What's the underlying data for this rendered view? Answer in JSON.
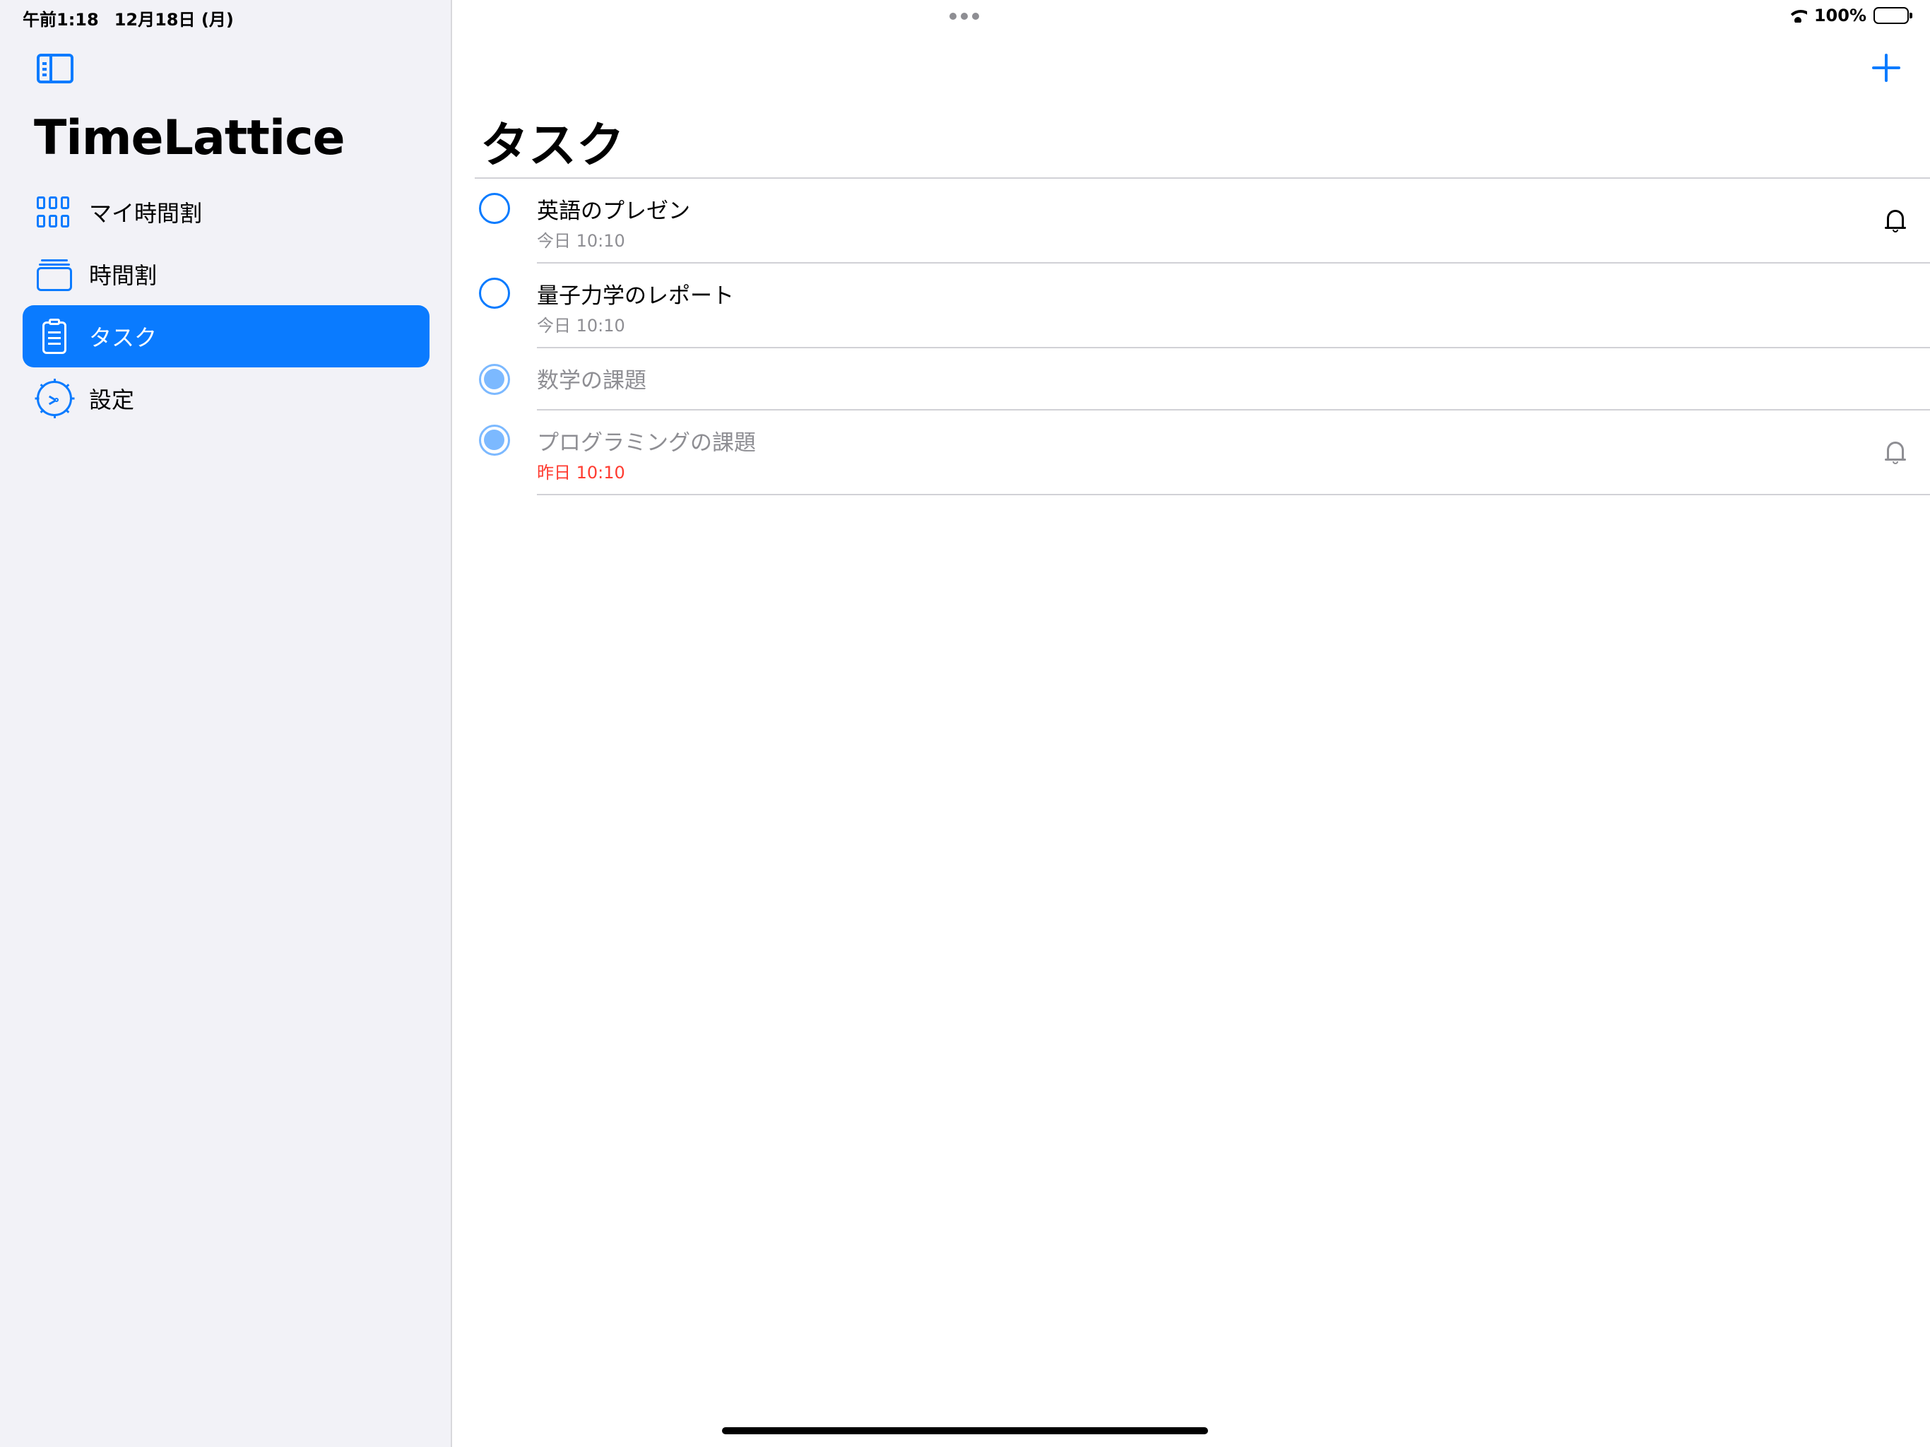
{
  "status_bar": {
    "time": "午前1:18",
    "date": "12月18日 (月)",
    "battery_percent": "100%"
  },
  "sidebar": {
    "title": "TimeLattice",
    "items": [
      {
        "label": "マイ時間割",
        "icon": "grid-icon",
        "selected": false
      },
      {
        "label": "時間割",
        "icon": "stacked-cards-icon",
        "selected": false
      },
      {
        "label": "タスク",
        "icon": "clipboard-list-icon",
        "selected": true
      },
      {
        "label": "設定",
        "icon": "gear-icon",
        "selected": false
      }
    ]
  },
  "main": {
    "title": "タスク",
    "tasks": [
      {
        "title": "英語のプレゼン",
        "subtitle": "今日 10:10",
        "completed": false,
        "alarm": true
      },
      {
        "title": "量子力学のレポート",
        "subtitle": "今日 10:10",
        "completed": false,
        "alarm": false
      },
      {
        "title": "数学の課題",
        "subtitle": "",
        "completed": true,
        "alarm": false
      },
      {
        "title": "プログラミングの課題",
        "subtitle": "昨日 10:10",
        "completed": true,
        "alarm": true,
        "overdue": true
      }
    ]
  },
  "colors": {
    "accent": "#0a7bff",
    "sidebar_bg": "#f2f2f7",
    "overdue": "#ff3b30",
    "secondary_text": "#8e8e93"
  }
}
